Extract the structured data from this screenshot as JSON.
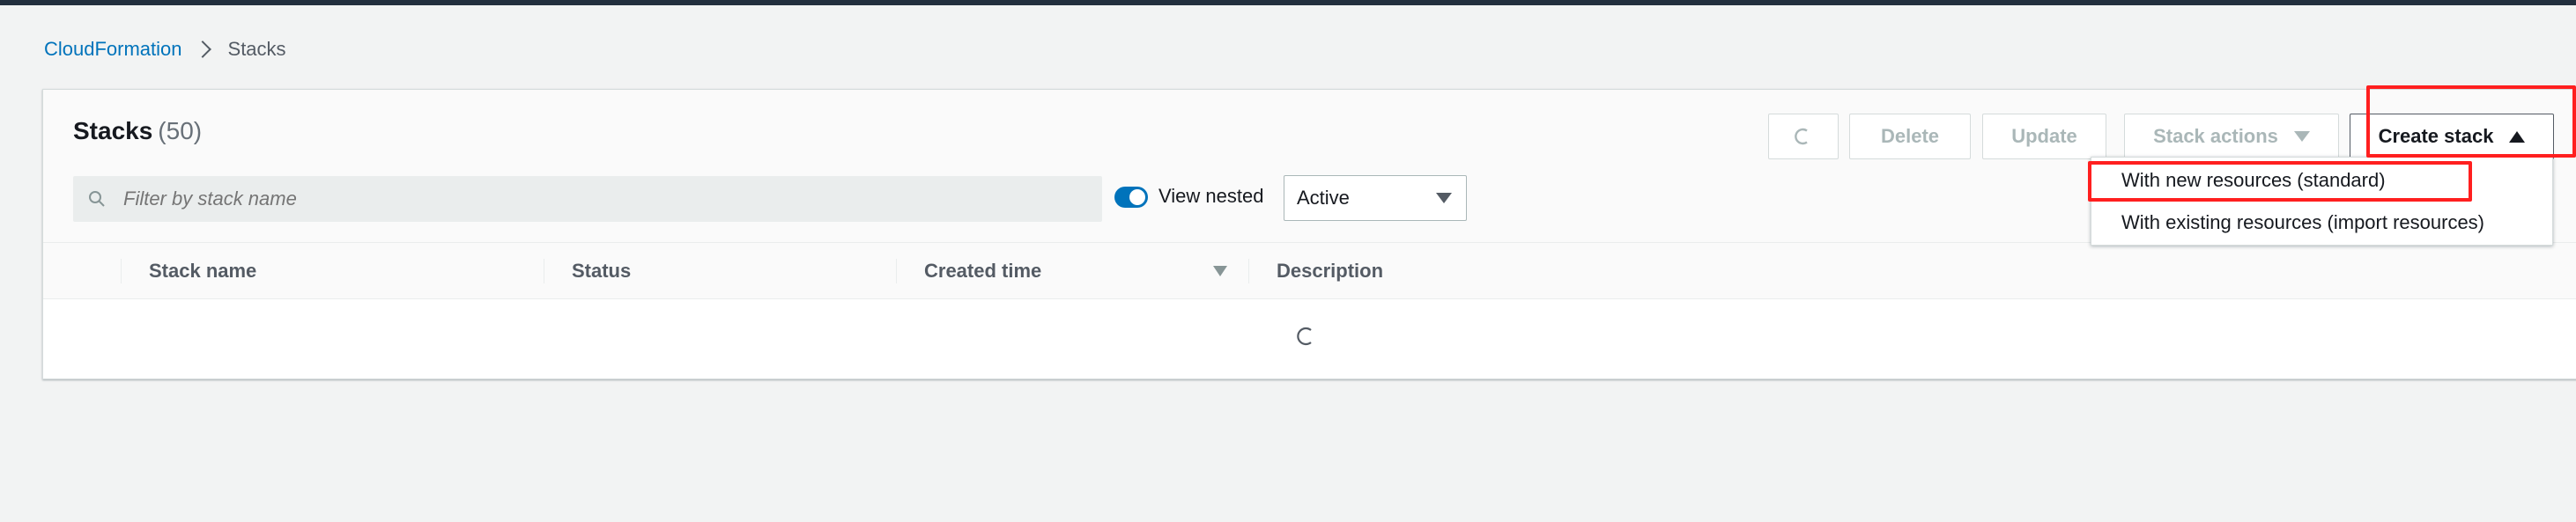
{
  "breadcrumb": {
    "parent": "CloudFormation",
    "current": "Stacks"
  },
  "panel": {
    "title": "Stacks",
    "count": "(50)"
  },
  "toolbar": {
    "refresh_icon": "refresh-icon",
    "delete_label": "Delete",
    "update_label": "Update",
    "stack_actions_label": "Stack actions",
    "create_stack_label": "Create stack"
  },
  "filter": {
    "placeholder": "Filter by stack name",
    "toggle_label": "View nested",
    "toggle_on": true,
    "status_select_value": "Active"
  },
  "table": {
    "columns": [
      {
        "label": "Stack name"
      },
      {
        "label": "Status"
      },
      {
        "label": "Created time"
      },
      {
        "label": "Description"
      }
    ],
    "loading_icon": "loading-spinner-icon"
  },
  "create_stack_menu": {
    "items": [
      {
        "label": "With new resources (standard)"
      },
      {
        "label": "With existing resources (import resources)"
      }
    ]
  },
  "colors": {
    "accent": "#0073bb",
    "header_bar": "#232f3e",
    "highlight": "#ff1f1f"
  }
}
